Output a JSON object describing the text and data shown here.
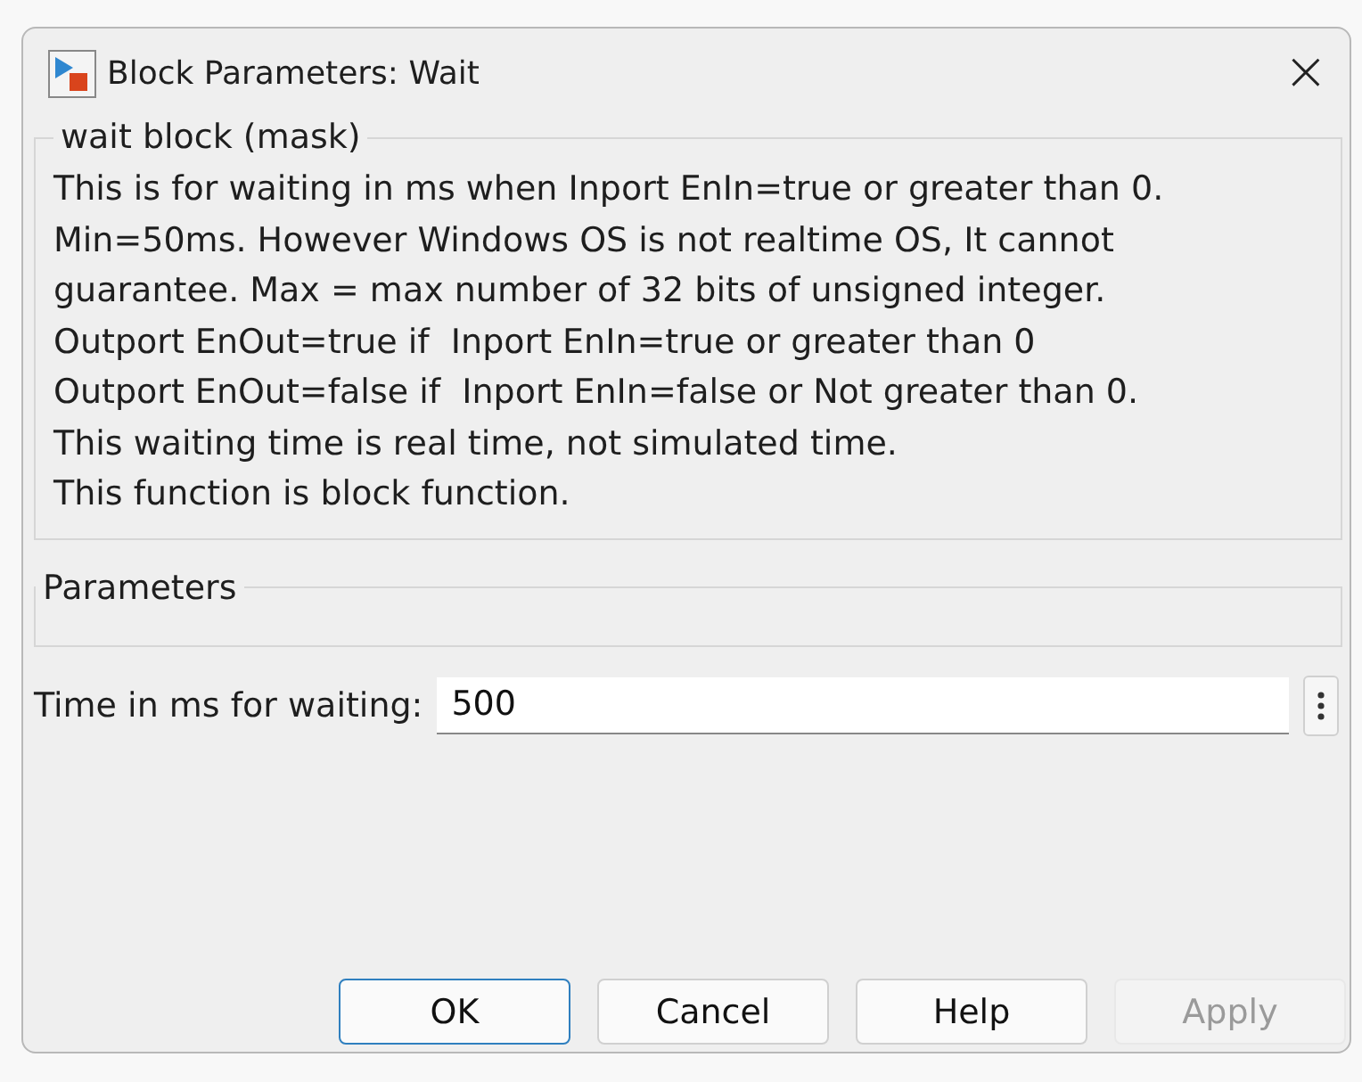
{
  "window": {
    "title": "Block Parameters: Wait",
    "close": "×"
  },
  "description": {
    "legend": "wait block (mask)",
    "text": "This is for waiting in ms when Inport EnIn=true or greater than 0.\nMin=50ms. However Windows OS is not realtime OS, It cannot\nguarantee. Max = max number of 32 bits of unsigned integer.\nOutport EnOut=true if  Inport EnIn=true or greater than 0\nOutport EnOut=false if  Inport EnIn=false or Not greater than 0.\nThis waiting time is real time, not simulated time.\nThis function is block function."
  },
  "parameters": {
    "legend": "Parameters",
    "fields": [
      {
        "label": "Time in ms for waiting:",
        "value": "500"
      }
    ]
  },
  "buttons": [
    {
      "label": "OK",
      "default": true,
      "disabled": false
    },
    {
      "label": "Cancel",
      "default": false,
      "disabled": false
    },
    {
      "label": "Help",
      "default": false,
      "disabled": false
    },
    {
      "label": "Apply",
      "default": false,
      "disabled": true
    }
  ]
}
